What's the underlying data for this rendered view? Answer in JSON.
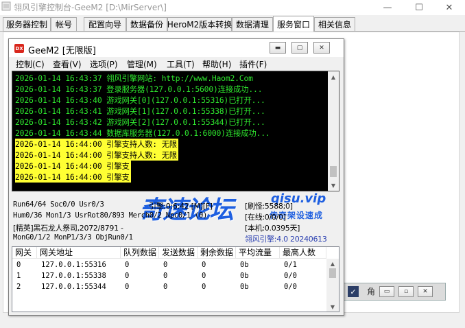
{
  "window": {
    "title": "翎风引擎控制台-GeeM2 [D:\\MirServer\\]",
    "min": "—",
    "max": "☐",
    "close": "✕"
  },
  "tabs": [
    {
      "label": "服务器控制"
    },
    {
      "label": "帐号"
    },
    {
      "label": "配置向导"
    },
    {
      "label": "数据备份"
    },
    {
      "label": "HeroM2版本转换"
    },
    {
      "label": "数据清理"
    },
    {
      "label": "服务窗口"
    },
    {
      "label": "相关信息"
    }
  ],
  "child_window": {
    "icon": "DX",
    "title": "GeeM2 [无限版]",
    "menu": [
      {
        "label": "控制(C)"
      },
      {
        "label": "查看(V)"
      },
      {
        "label": "选项(P)"
      },
      {
        "label": "管理(M)"
      },
      {
        "label": "工具(T)"
      },
      {
        "label": "帮助(H)"
      },
      {
        "label": "插件(F)"
      }
    ]
  },
  "console": {
    "lines": [
      {
        "text": "2026-01-14 16:43:37 翎风引擎网站: http://www.Haom2.Com",
        "style": "green"
      },
      {
        "text": "2026-01-14 16:43:37 登录服务器(127.0.0.1:5600)连接成功...",
        "style": "green"
      },
      {
        "text": "2026-01-14 16:43:40 游戏网关[0](127.0.0.1:55316)已打开...",
        "style": "green"
      },
      {
        "text": "2026-01-14 16:43:41 游戏网关[1](127.0.0.1:55338)已打开...",
        "style": "green"
      },
      {
        "text": "2026-01-14 16:43:42 游戏网关[2](127.0.0.1:55344)已打开...",
        "style": "green"
      },
      {
        "text": "2026-01-14 16:43:44 数据库服务器(127.0.0.1:6000)连接成功...",
        "style": "green"
      },
      {
        "text": "2026-01-14 16:44:00 引擎支持人数: 无限",
        "style": "yellow"
      },
      {
        "text": "2026-01-14 16:44:00 引擎支持人数: 无限",
        "style": "yellow"
      },
      {
        "text": "2026-01-14 16:44:00 引擎支",
        "style": "yellow"
      },
      {
        "text": "2026-01-14 16:44:00 引擎支",
        "style": "yellow"
      }
    ]
  },
  "watermark": {
    "big": "奇速论坛",
    "url": "qisu.vip",
    "sub": "传奇架设速成"
  },
  "status": {
    "run": "Run64/64 Soc0/0 Usr0/3",
    "engine": "引擎:0:6:42 [M][F]",
    "refresh": "[刷怪:5588;0]",
    "hum": "Hum0/36 Mon1/3 UsrRot80/893 Merch0/2 Npc0/1 (0)",
    "online": "[在线:0/0/0]",
    "elite": "[精英]黑石龙人祭司,2072/8791 -",
    "local": "[本机:0.0395天]",
    "mon": "MonG0/1/2 MonP1/3/3 ObjRun0/1",
    "version": "翎风引擎:4.0 20240613"
  },
  "gateway_table": {
    "headers": [
      "网关",
      "网关地址",
      "队列数据",
      "发送数据",
      "剩余数据",
      "平均流量",
      "最高人数"
    ],
    "rows": [
      [
        "0",
        "127.0.0.1:55316",
        "0",
        "0",
        "0",
        "0b",
        "0/1"
      ],
      [
        "1",
        "127.0.0.1:55338",
        "0",
        "0",
        "0",
        "0b",
        "0/0"
      ],
      [
        "2",
        "127.0.0.1:55344",
        "0",
        "0",
        "0",
        "0b",
        "0/0"
      ]
    ]
  },
  "bg_window": {
    "label": "角"
  }
}
